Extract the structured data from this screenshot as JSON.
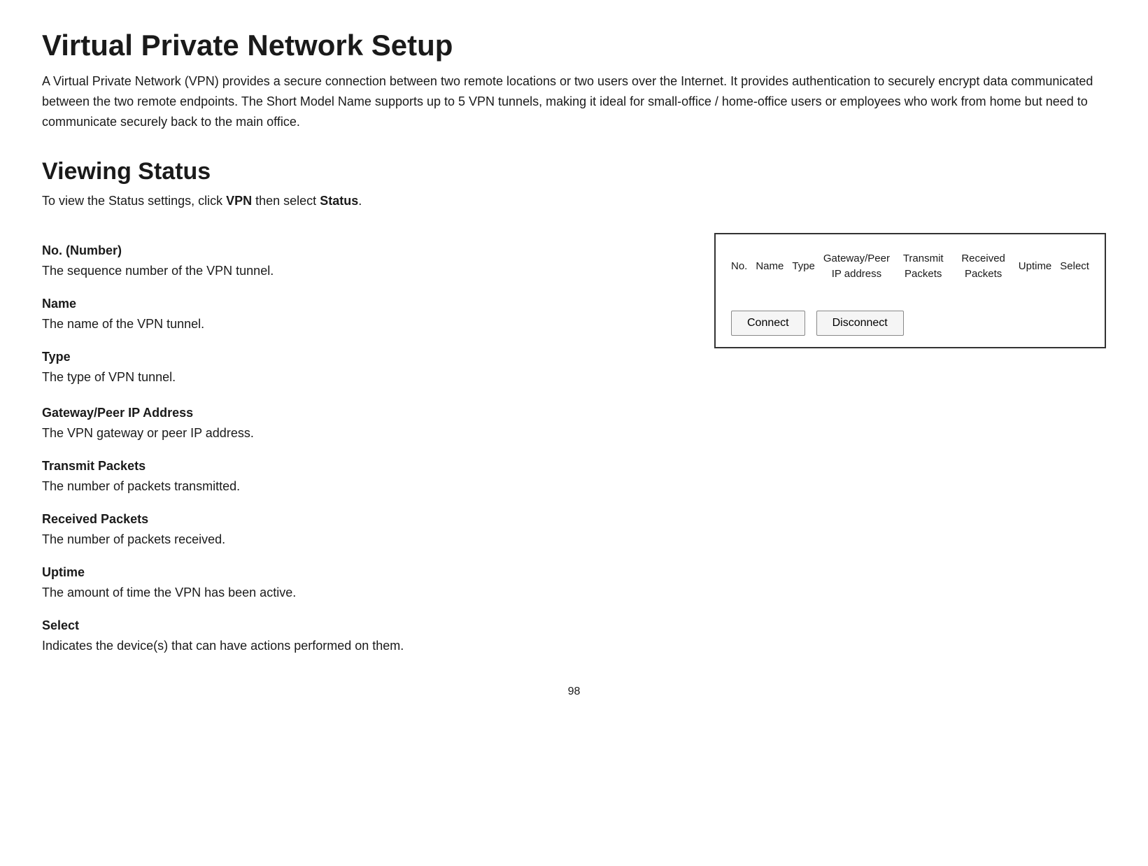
{
  "page": {
    "title": "Virtual Private Network Setup",
    "intro": "A Virtual Private Network (VPN) provides a secure connection between two remote locations or two users over the Internet. It provides authentication to securely encrypt data communicated between the two remote endpoints. The Short Model Name supports up to 5 VPN tunnels, making it ideal for small-office / home-office  users or employees who work from home but need to communicate securely back to the main office.",
    "viewing_status": {
      "title": "Viewing Status",
      "intro_prefix": "To view the Status settings, click ",
      "intro_bold1": "VPN",
      "intro_middle": " then select ",
      "intro_bold2": "Status",
      "intro_suffix": "."
    },
    "fields": [
      {
        "name": "no_number",
        "title": "No. (Number)",
        "desc": "The sequence number of the VPN tunnel."
      },
      {
        "name": "name",
        "title": "Name",
        "desc": "The name of the VPN tunnel."
      },
      {
        "name": "type",
        "title": "Type",
        "desc": "The type of VPN tunnel."
      },
      {
        "name": "gateway_peer",
        "title": "Gateway/Peer IP Address",
        "desc": "The VPN gateway or peer IP address."
      },
      {
        "name": "transmit_packets",
        "title": "Transmit Packets",
        "desc": "The number of packets transmitted."
      },
      {
        "name": "received_packets",
        "title": "Received Packets",
        "desc": "The number of packets received."
      },
      {
        "name": "uptime",
        "title": "Uptime",
        "desc": "The amount of time the VPN has been active."
      },
      {
        "name": "select",
        "title": "Select",
        "desc": "Indicates the device(s) that can have actions performed on them."
      }
    ],
    "table": {
      "columns": [
        "No.",
        "Name",
        "Type",
        "Gateway/Peer\nIP address",
        "Transmit Packets",
        "Received Packets",
        "Uptime",
        "Select"
      ],
      "buttons": [
        "Connect",
        "Disconnect"
      ]
    },
    "page_number": "98"
  }
}
